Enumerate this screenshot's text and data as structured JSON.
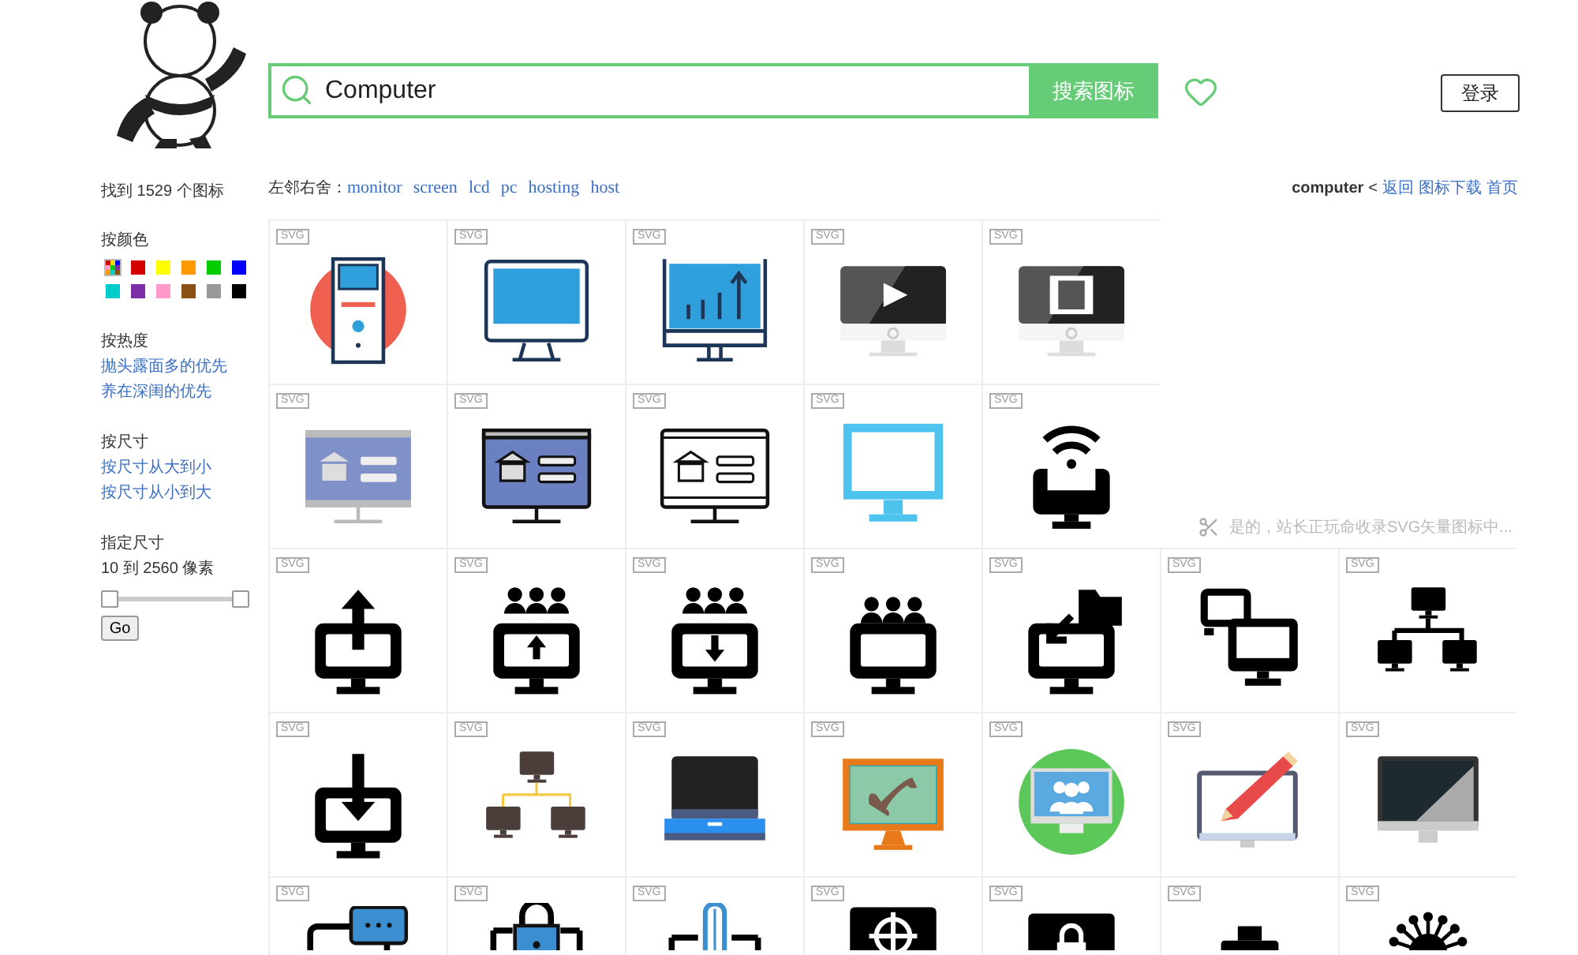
{
  "header": {
    "search": {
      "value": "Computer"
    },
    "search_button": "搜索图标",
    "login_button": "登录"
  },
  "sidebar": {
    "result_count": "找到 1529 个图标",
    "color_filter": {
      "title": "按颜色",
      "swatches": [
        {
          "kind": "all"
        },
        {
          "kind": "color",
          "color": "#d40000"
        },
        {
          "kind": "color",
          "color": "#ffff00"
        },
        {
          "kind": "color",
          "color": "#ff9900"
        },
        {
          "kind": "color",
          "color": "#00cc00"
        },
        {
          "kind": "color",
          "color": "#0000ff"
        },
        {
          "kind": "color",
          "color": "#00cccc"
        },
        {
          "kind": "color",
          "color": "#7a2fa8"
        },
        {
          "kind": "color",
          "color": "#ff99cc"
        },
        {
          "kind": "color",
          "color": "#8b5013"
        },
        {
          "kind": "color",
          "color": "#999999"
        },
        {
          "kind": "color",
          "color": "#000000"
        }
      ]
    },
    "popularity": {
      "title": "按热度",
      "links": [
        "抛头露面多的优先",
        "养在深闺的优先"
      ]
    },
    "size_sort": {
      "title": "按尺寸",
      "links": [
        "按尺寸从大到小",
        "按尺寸从小到大"
      ]
    },
    "size_range": {
      "title": "指定尺寸",
      "reading": "10 到 2560 像素",
      "thumbs": [
        {
          "level": 0
        },
        {
          "level": 1
        }
      ],
      "button": "Go"
    }
  },
  "related": {
    "label": "左邻右舍：",
    "tags": [
      "monitor",
      "screen",
      "lcd",
      "pc",
      "hosting",
      "host"
    ]
  },
  "breadcrumb": {
    "current": "computer",
    "separator": "<",
    "links": [
      "返回",
      "图标下载",
      "首页"
    ]
  },
  "notice": "是的，站长正玩命收录SVG矢量图标中...",
  "icon_rows": [
    {
      "tiles": [
        "SVG",
        "SVG",
        "SVG",
        "SVG",
        "SVG"
      ]
    },
    {
      "tiles": [
        "SVG",
        "SVG",
        "SVG",
        "SVG",
        "SVG"
      ]
    },
    {
      "tiles": [
        "SVG",
        "SVG",
        "SVG",
        "SVG",
        "SVG",
        "SVG",
        "SVG"
      ]
    },
    {
      "tiles": [
        "SVG",
        "SVG",
        "SVG",
        "SVG",
        "SVG",
        "SVG",
        "SVG"
      ]
    },
    {
      "tiles": [
        "SVG",
        "SVG",
        "SVG",
        "SVG",
        "SVG",
        "SVG",
        "SVG"
      ]
    }
  ]
}
